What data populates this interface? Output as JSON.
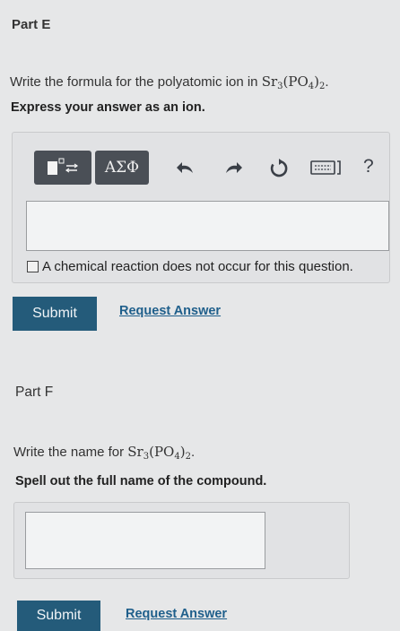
{
  "partE": {
    "title": "Part E",
    "question_prefix": "Write the formula for the polyatomic ion in ",
    "formula": {
      "a": "Sr",
      "a_sub": "3",
      "b": "(PO",
      "b_sub": "4",
      "c": ")",
      "c_sub": "2"
    },
    "question_suffix": ".",
    "instruction": "Express your answer as an ion.",
    "toolbar": {
      "templates_icon": "template-icon",
      "greek_label": "ΑΣΦ",
      "undo_icon": "undo-icon",
      "redo_icon": "redo-icon",
      "reset_icon": "reset-icon",
      "keyboard_icon": "keyboard-icon",
      "help_label": "?"
    },
    "checkbox_label": "A chemical reaction does not occur for this question.",
    "submit_label": "Submit",
    "request_label": "Request Answer"
  },
  "partF": {
    "title": "Part F",
    "question_prefix": "Write the name for ",
    "formula": {
      "a": "Sr",
      "a_sub": "3",
      "b": "(PO",
      "b_sub": "4",
      "c": ")",
      "c_sub": "2"
    },
    "question_suffix": ".",
    "instruction": "Spell out the full name of the compound.",
    "submit_label": "Submit",
    "request_label": "Request Answer"
  },
  "colors": {
    "background": "#e6e7e8",
    "submit_bg": "#245b7a",
    "link": "#1f5f8b",
    "toolbar_btn": "#4a4f56"
  }
}
